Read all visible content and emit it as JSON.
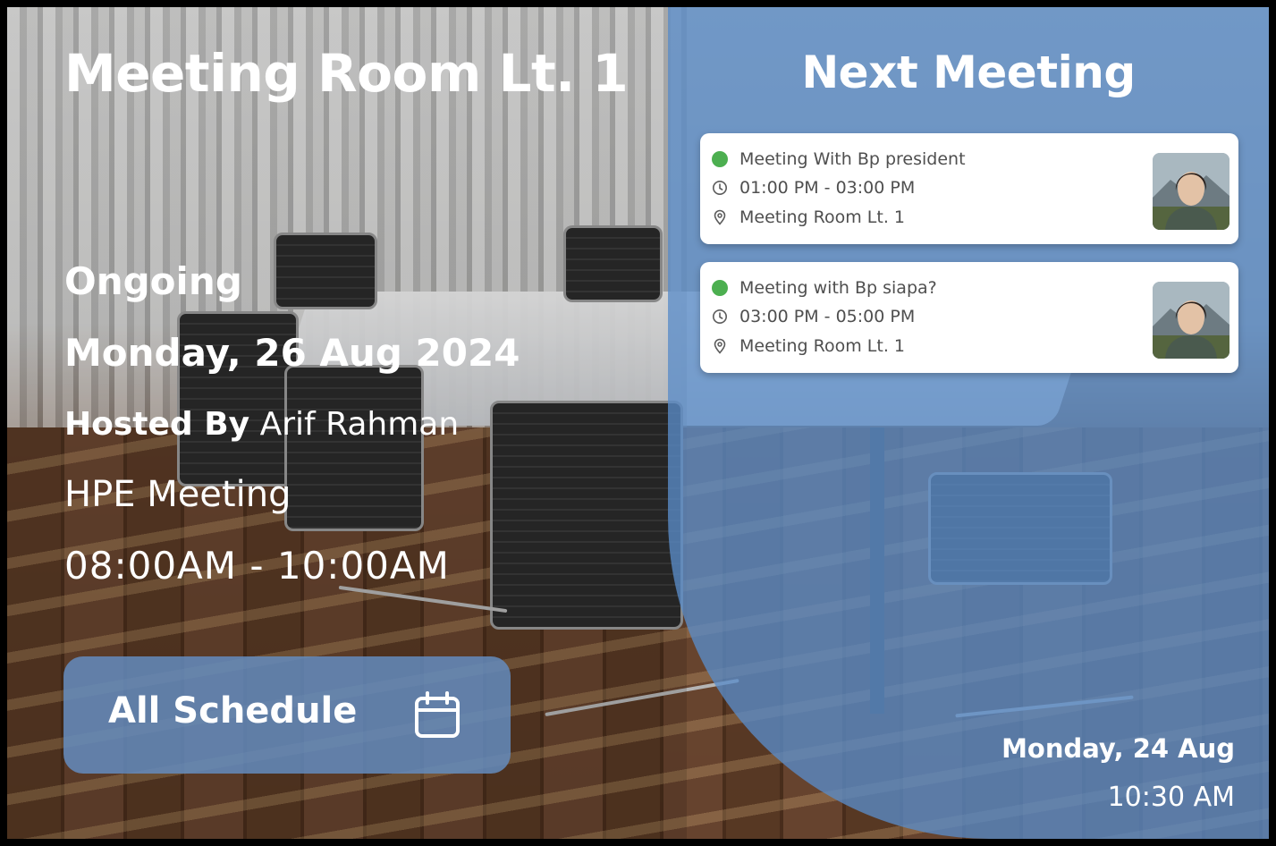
{
  "room": {
    "title": "Meeting Room Lt. 1",
    "status": "Ongoing",
    "date": "Monday, 26 Aug 2024",
    "hosted_by_label": "Hosted By",
    "host_name": "Arif Rahman",
    "meeting_name": "HPE Meeting",
    "meeting_time": "08:00AM - 10:00AM",
    "schedule_button_label": "All Schedule",
    "schedule_button_icon": "calendar-icon"
  },
  "next_meeting": {
    "title": "Next Meeting",
    "items": [
      {
        "title": "Meeting With Bp president",
        "time": "01:00 PM - 03:00 PM",
        "location": "Meeting Room Lt. 1",
        "status_color": "#4caf50"
      },
      {
        "title": "Meeting with Bp siapa?",
        "time": "03:00 PM - 05:00 PM",
        "location": "Meeting Room Lt. 1",
        "status_color": "#4caf50"
      }
    ]
  },
  "footer": {
    "date": "Monday, 24 Aug",
    "time": "10:30 AM"
  },
  "colors": {
    "panel_blue": "#5a8cc8",
    "button_blue": "#648cbe",
    "status_green": "#4caf50"
  }
}
